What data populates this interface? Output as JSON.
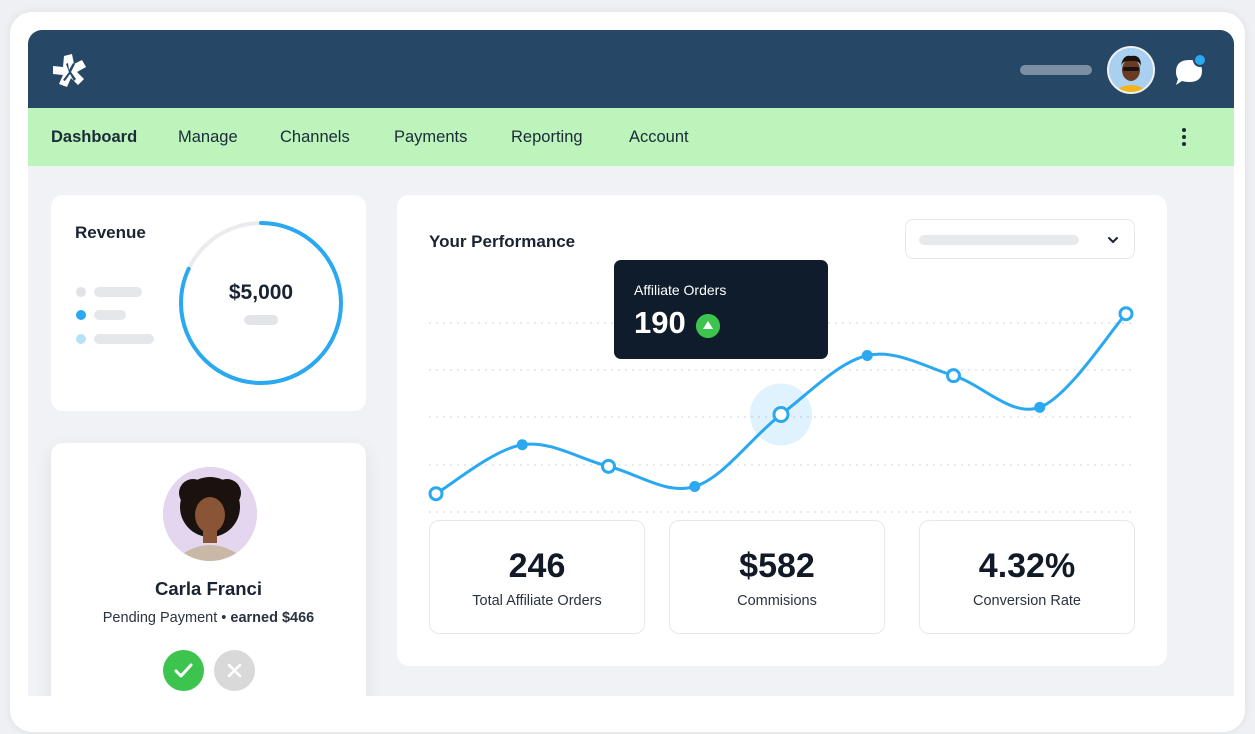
{
  "nav": {
    "items": [
      "Dashboard",
      "Manage",
      "Channels",
      "Payments",
      "Reporting",
      "Account"
    ],
    "active": "Dashboard"
  },
  "revenue": {
    "title": "Revenue",
    "value": "$5,000",
    "ring_progress": 0.82,
    "accent": "#2aa8f0"
  },
  "user": {
    "name": "Carla Franci",
    "status": "Pending Payment",
    "earned_prefix": "earned",
    "earned_amount": "$466"
  },
  "performance": {
    "title": "Your Performance",
    "tooltip": {
      "label": "Affiliate Orders",
      "value": "190"
    }
  },
  "chart_data": {
    "type": "line",
    "title": "Your Performance",
    "x": [
      1,
      2,
      3,
      4,
      5,
      6,
      7,
      8,
      9
    ],
    "series": [
      {
        "name": "",
        "values": [
          12,
          46,
          31,
          17,
          67,
          108,
          94,
          72,
          137
        ]
      }
    ],
    "ylim": [
      0,
      150
    ],
    "highlight_index": 4,
    "grid": true,
    "color": "#2aa8f0"
  },
  "stats": [
    {
      "value": "246",
      "label": "Total Affiliate Orders"
    },
    {
      "value": "$582",
      "label": "Commisions"
    },
    {
      "value": "4.32%",
      "label": "Conversion Rate"
    }
  ],
  "icons": {
    "logo": "star-logo-icon",
    "chat": "chat-icon",
    "more": "more-vertical-icon",
    "dropdown": "chevron-down-icon",
    "approve": "check-icon",
    "reject": "x-icon",
    "trend": "triangle-up-icon"
  },
  "colors": {
    "topbar": "#264766",
    "navbar": "#bcf4bb",
    "approve": "#3cc44e",
    "tooltip": "#0f1c2c"
  }
}
